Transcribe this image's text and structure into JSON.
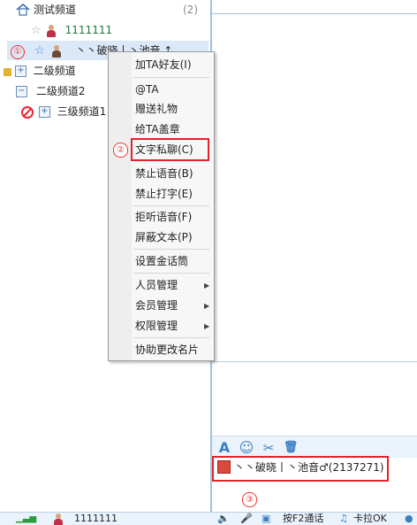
{
  "tree": {
    "root": {
      "label": "测试频道",
      "count": "(2)"
    },
    "user1": {
      "id_text": "1111111"
    },
    "selected_user": {
      "marker": "①",
      "name": "丶丶破晓丨丶池音 ↕"
    },
    "ch2a": {
      "label": "二级频道"
    },
    "ch2b": {
      "label": "二级频道2"
    },
    "ch3": {
      "label": "三级频道1"
    }
  },
  "context_menu": {
    "add_friend": "加TA好友(I)",
    "at_ta": "@TA",
    "send_gift": "赠送礼物",
    "stamp": "给TA盖章",
    "private_chat": "文字私聊(C)",
    "mute_voice": "禁止语音(B)",
    "mute_text": "禁止打字(E)",
    "refuse_voice": "拒听语音(F)",
    "block_text": "屏蔽文本(P)",
    "golden_mic": "设置金话筒",
    "member_mgmt": "人员管理",
    "vip_mgmt": "会员管理",
    "perm_mgmt": "权限管理",
    "change_card": "协助更改名片"
  },
  "annotations": {
    "one": "①",
    "two": "②",
    "three": "③"
  },
  "chat": {
    "toolbar": {
      "font": "A",
      "emoji": "☺",
      "cut": "✂",
      "clear": "🗑"
    },
    "target_user": "丶丶破晓丨丶池音♂(2137271)"
  },
  "status_bar": {
    "user_id": "1111111",
    "ptt": "按F2通话",
    "karaoke": "卡拉OK"
  },
  "colors": {
    "highlight": "#e0242c",
    "accent": "#3a7fc1"
  }
}
